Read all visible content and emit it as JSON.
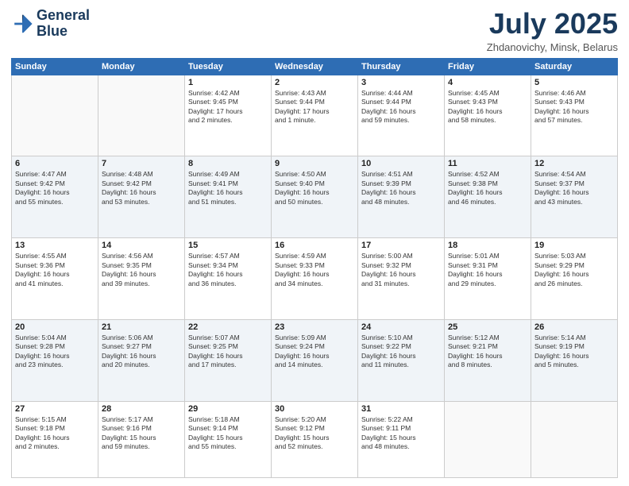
{
  "header": {
    "logo_line1": "General",
    "logo_line2": "Blue",
    "month": "July 2025",
    "location": "Zhdanovichy, Minsk, Belarus"
  },
  "days_of_week": [
    "Sunday",
    "Monday",
    "Tuesday",
    "Wednesday",
    "Thursday",
    "Friday",
    "Saturday"
  ],
  "weeks": [
    [
      {
        "day": "",
        "info": ""
      },
      {
        "day": "",
        "info": ""
      },
      {
        "day": "1",
        "info": "Sunrise: 4:42 AM\nSunset: 9:45 PM\nDaylight: 17 hours\nand 2 minutes."
      },
      {
        "day": "2",
        "info": "Sunrise: 4:43 AM\nSunset: 9:44 PM\nDaylight: 17 hours\nand 1 minute."
      },
      {
        "day": "3",
        "info": "Sunrise: 4:44 AM\nSunset: 9:44 PM\nDaylight: 16 hours\nand 59 minutes."
      },
      {
        "day": "4",
        "info": "Sunrise: 4:45 AM\nSunset: 9:43 PM\nDaylight: 16 hours\nand 58 minutes."
      },
      {
        "day": "5",
        "info": "Sunrise: 4:46 AM\nSunset: 9:43 PM\nDaylight: 16 hours\nand 57 minutes."
      }
    ],
    [
      {
        "day": "6",
        "info": "Sunrise: 4:47 AM\nSunset: 9:42 PM\nDaylight: 16 hours\nand 55 minutes."
      },
      {
        "day": "7",
        "info": "Sunrise: 4:48 AM\nSunset: 9:42 PM\nDaylight: 16 hours\nand 53 minutes."
      },
      {
        "day": "8",
        "info": "Sunrise: 4:49 AM\nSunset: 9:41 PM\nDaylight: 16 hours\nand 51 minutes."
      },
      {
        "day": "9",
        "info": "Sunrise: 4:50 AM\nSunset: 9:40 PM\nDaylight: 16 hours\nand 50 minutes."
      },
      {
        "day": "10",
        "info": "Sunrise: 4:51 AM\nSunset: 9:39 PM\nDaylight: 16 hours\nand 48 minutes."
      },
      {
        "day": "11",
        "info": "Sunrise: 4:52 AM\nSunset: 9:38 PM\nDaylight: 16 hours\nand 46 minutes."
      },
      {
        "day": "12",
        "info": "Sunrise: 4:54 AM\nSunset: 9:37 PM\nDaylight: 16 hours\nand 43 minutes."
      }
    ],
    [
      {
        "day": "13",
        "info": "Sunrise: 4:55 AM\nSunset: 9:36 PM\nDaylight: 16 hours\nand 41 minutes."
      },
      {
        "day": "14",
        "info": "Sunrise: 4:56 AM\nSunset: 9:35 PM\nDaylight: 16 hours\nand 39 minutes."
      },
      {
        "day": "15",
        "info": "Sunrise: 4:57 AM\nSunset: 9:34 PM\nDaylight: 16 hours\nand 36 minutes."
      },
      {
        "day": "16",
        "info": "Sunrise: 4:59 AM\nSunset: 9:33 PM\nDaylight: 16 hours\nand 34 minutes."
      },
      {
        "day": "17",
        "info": "Sunrise: 5:00 AM\nSunset: 9:32 PM\nDaylight: 16 hours\nand 31 minutes."
      },
      {
        "day": "18",
        "info": "Sunrise: 5:01 AM\nSunset: 9:31 PM\nDaylight: 16 hours\nand 29 minutes."
      },
      {
        "day": "19",
        "info": "Sunrise: 5:03 AM\nSunset: 9:29 PM\nDaylight: 16 hours\nand 26 minutes."
      }
    ],
    [
      {
        "day": "20",
        "info": "Sunrise: 5:04 AM\nSunset: 9:28 PM\nDaylight: 16 hours\nand 23 minutes."
      },
      {
        "day": "21",
        "info": "Sunrise: 5:06 AM\nSunset: 9:27 PM\nDaylight: 16 hours\nand 20 minutes."
      },
      {
        "day": "22",
        "info": "Sunrise: 5:07 AM\nSunset: 9:25 PM\nDaylight: 16 hours\nand 17 minutes."
      },
      {
        "day": "23",
        "info": "Sunrise: 5:09 AM\nSunset: 9:24 PM\nDaylight: 16 hours\nand 14 minutes."
      },
      {
        "day": "24",
        "info": "Sunrise: 5:10 AM\nSunset: 9:22 PM\nDaylight: 16 hours\nand 11 minutes."
      },
      {
        "day": "25",
        "info": "Sunrise: 5:12 AM\nSunset: 9:21 PM\nDaylight: 16 hours\nand 8 minutes."
      },
      {
        "day": "26",
        "info": "Sunrise: 5:14 AM\nSunset: 9:19 PM\nDaylight: 16 hours\nand 5 minutes."
      }
    ],
    [
      {
        "day": "27",
        "info": "Sunrise: 5:15 AM\nSunset: 9:18 PM\nDaylight: 16 hours\nand 2 minutes."
      },
      {
        "day": "28",
        "info": "Sunrise: 5:17 AM\nSunset: 9:16 PM\nDaylight: 15 hours\nand 59 minutes."
      },
      {
        "day": "29",
        "info": "Sunrise: 5:18 AM\nSunset: 9:14 PM\nDaylight: 15 hours\nand 55 minutes."
      },
      {
        "day": "30",
        "info": "Sunrise: 5:20 AM\nSunset: 9:12 PM\nDaylight: 15 hours\nand 52 minutes."
      },
      {
        "day": "31",
        "info": "Sunrise: 5:22 AM\nSunset: 9:11 PM\nDaylight: 15 hours\nand 48 minutes."
      },
      {
        "day": "",
        "info": ""
      },
      {
        "day": "",
        "info": ""
      }
    ]
  ]
}
